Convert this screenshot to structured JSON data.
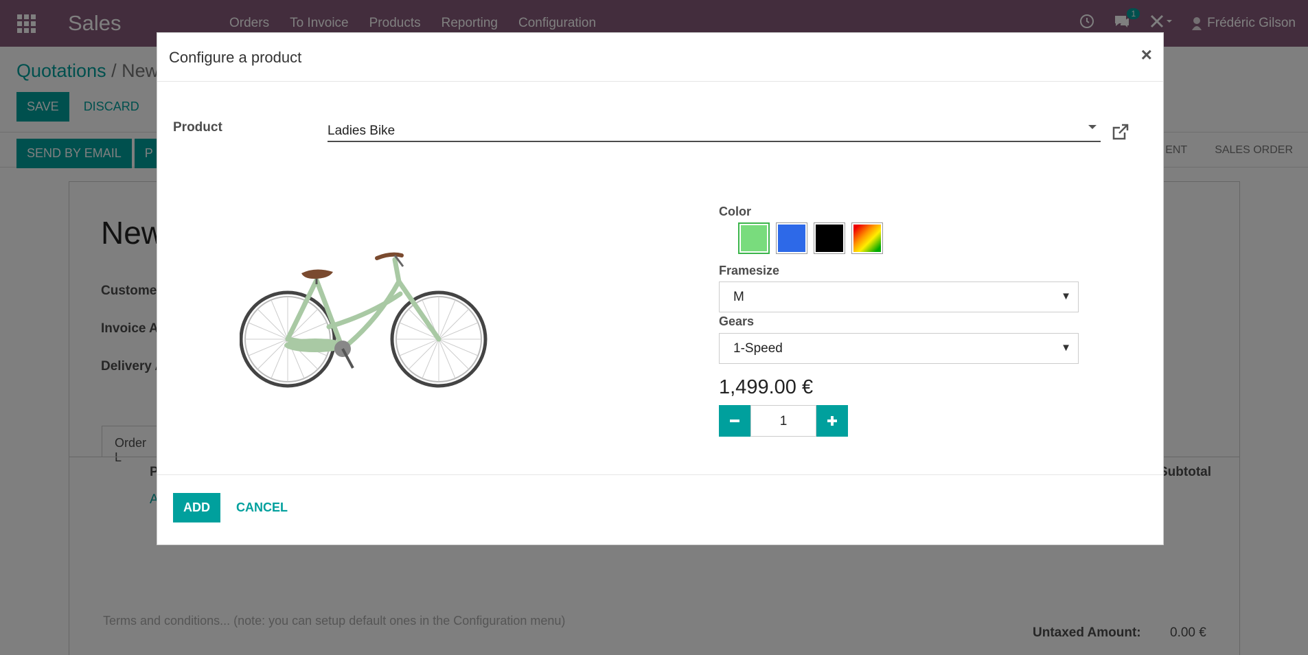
{
  "navbar": {
    "app_name": "Sales",
    "menu": [
      "Orders",
      "To Invoice",
      "Products",
      "Reporting",
      "Configuration"
    ],
    "chat_badge": "1",
    "user_name": "Frédéric Gilson",
    "bg_color": "#875a7b"
  },
  "control_panel": {
    "breadcrumb_parent": "Quotations",
    "breadcrumb_sep": "/",
    "breadcrumb_current": "New",
    "save_label": "SAVE",
    "discard_label": "DISCARD",
    "send_email_label": "SEND BY EMAIL",
    "second_label": "P",
    "status_sent": "ENT",
    "status_sales_order": "SALES ORDER"
  },
  "sheet": {
    "title": "New",
    "customer_label": "Customer",
    "invoice_label": "Invoice A",
    "delivery_label": "Delivery A",
    "tab_order_lines": "Order L",
    "col_product": "P",
    "add_line": "A",
    "subtotal_header": "Subtotal",
    "terms_placeholder": "Terms and conditions... (note: you can setup default ones in the Configuration menu)",
    "untaxed_label": "Untaxed Amount:",
    "untaxed_value": "0.00 €"
  },
  "modal": {
    "title": "Configure a product",
    "close_label": "×",
    "product_label": "Product",
    "product_value": "Ladies Bike",
    "color_label": "Color",
    "colors": [
      {
        "name": "green",
        "value": "#79dc7d",
        "active": true
      },
      {
        "name": "blue",
        "value": "#2d69e8",
        "active": false
      },
      {
        "name": "black",
        "value": "#000000",
        "active": false
      },
      {
        "name": "rainbow",
        "value": "linear-gradient",
        "active": false
      }
    ],
    "framesize_label": "Framesize",
    "framesize_value": "M",
    "gears_label": "Gears",
    "gears_value": "1-Speed",
    "price": "1,499.00 €",
    "quantity": "1",
    "add_label": "ADD",
    "cancel_label": "CANCEL",
    "accent_color": "#00a09d"
  }
}
